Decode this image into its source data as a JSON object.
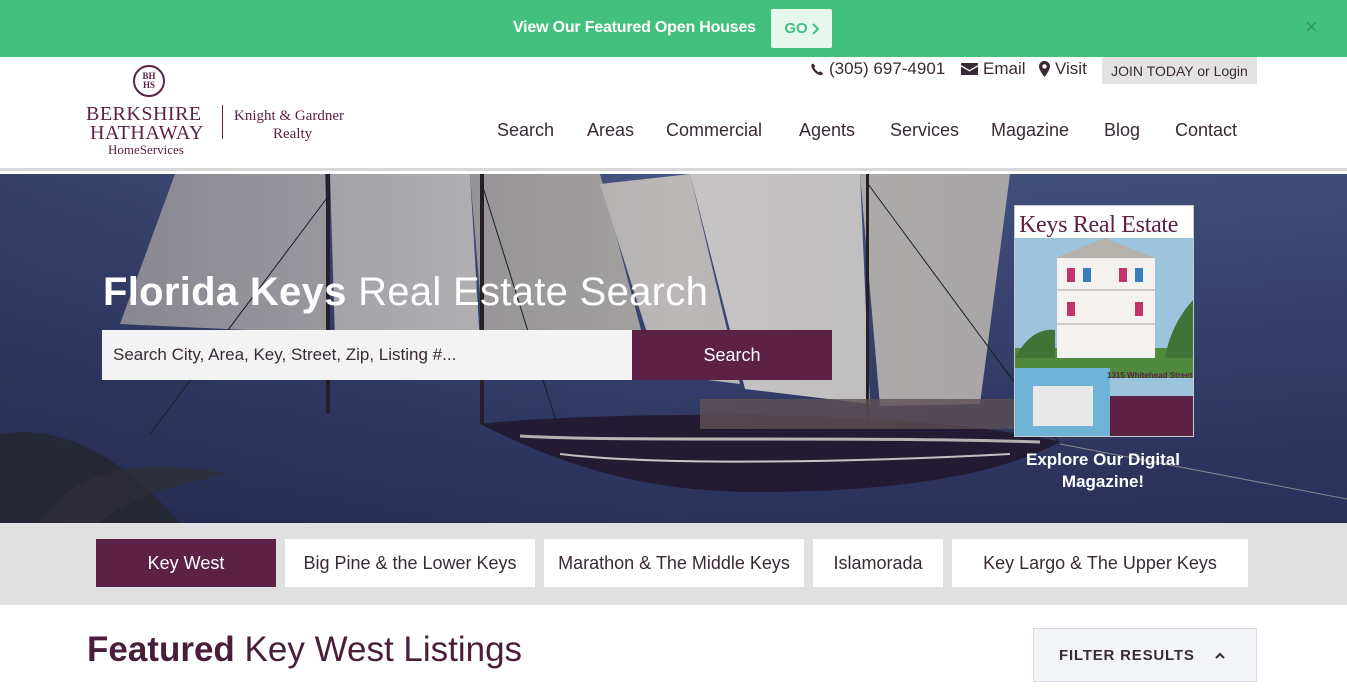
{
  "banner": {
    "text": "View Our Featured Open Houses",
    "go_label": "GO",
    "close_icon": "×"
  },
  "logo": {
    "seal_line1": "BH",
    "seal_line2": "HS",
    "line1": "BERKSHIRE",
    "line2": "HATHAWAY",
    "line3": "HomeServices",
    "partner_line1": "Knight & Gardner",
    "partner_line2": "Realty"
  },
  "contact": {
    "phone": "(305) 697-4901",
    "email": "Email",
    "visit": "Visit",
    "join": "JOIN TODAY or Login"
  },
  "nav": [
    "Search",
    "Areas",
    "Commercial",
    "Agents",
    "Services",
    "Magazine",
    "Blog",
    "Contact"
  ],
  "hero": {
    "title_bold": "Florida Keys",
    "title_rest": " Real Estate Search",
    "search_placeholder": "Search City, Area, Key, Street, Zip, Listing #...",
    "search_button": "Search",
    "magazine_title": "Keys Real Estate",
    "magazine_address": "1315 Whitehead Street",
    "magazine_caption_line1": "Explore Our Digital",
    "magazine_caption_line2": "Magazine!"
  },
  "area_tabs": [
    {
      "label": "Key West",
      "active": true
    },
    {
      "label": "Big Pine & the Lower Keys",
      "active": false
    },
    {
      "label": "Marathon & The Middle Keys",
      "active": false
    },
    {
      "label": "Islamorada",
      "active": false
    },
    {
      "label": "Key Largo & The Upper Keys",
      "active": false
    }
  ],
  "featured": {
    "title_bold": "Featured",
    "title_rest": " Key West Listings",
    "filter_label": "FILTER RESULTS"
  },
  "colors": {
    "banner": "#43c07e",
    "brand_plum": "#5c2145",
    "tabs_bg": "#e0e0e0"
  },
  "icons": {
    "phone": "phone-icon",
    "email": "envelope-icon",
    "visit": "map-pin-icon",
    "go": "chevron-right-icon",
    "filter": "chevron-up-icon",
    "close": "close-icon"
  }
}
